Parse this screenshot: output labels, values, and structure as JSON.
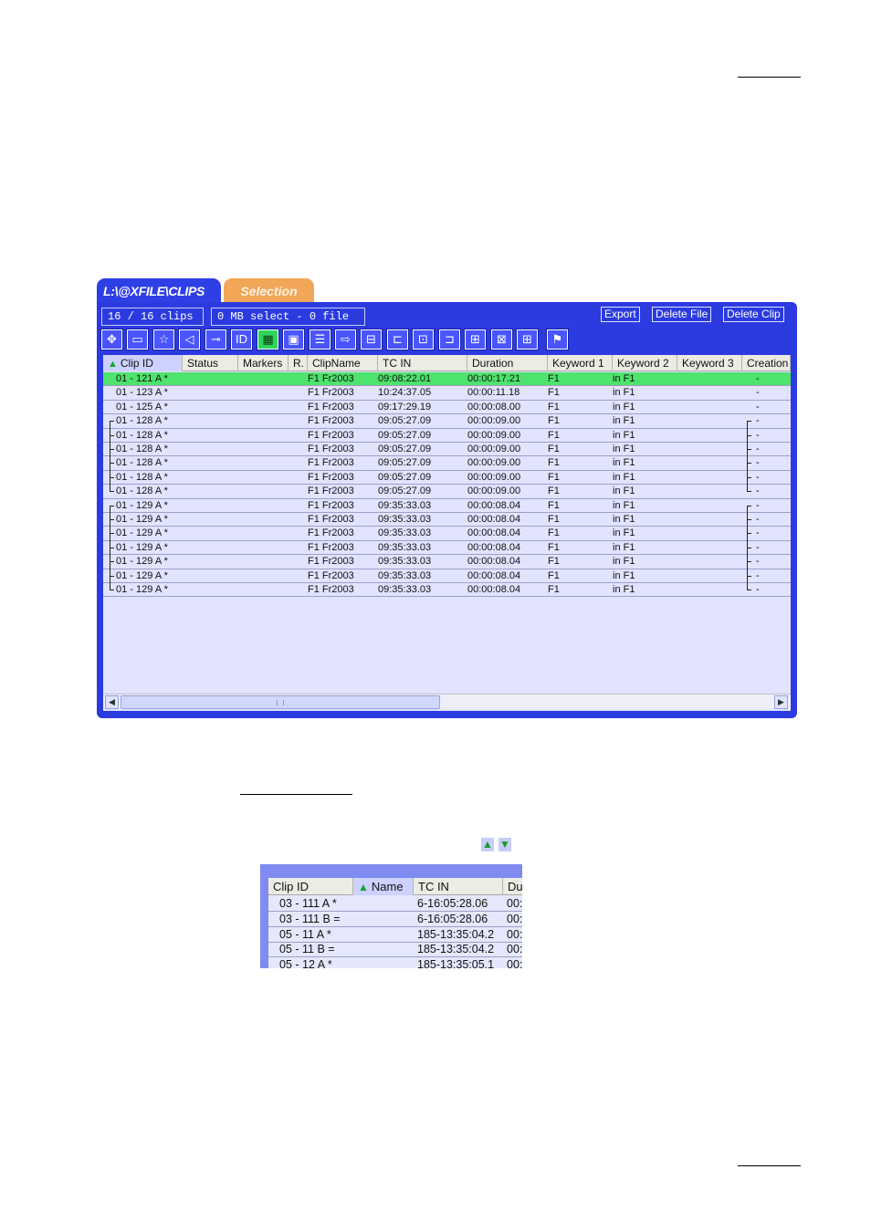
{
  "tabs": [
    {
      "label": "L:\\@XFILE\\CLIPS"
    },
    {
      "label": "Selection"
    }
  ],
  "status": {
    "clips_count": "16 / 16 clips",
    "selection_info": "0 MB select - 0 file"
  },
  "actions": {
    "export": "Export",
    "delete_file": "Delete File",
    "delete_clip": "Delete Clip"
  },
  "toolbar_icons": [
    "target-icon",
    "clip-icon",
    "star-icon",
    "tag-icon",
    "key-icon",
    "id-icon",
    "grid-view-icon",
    "frame-icon",
    "list-view-icon",
    "transfer-icon",
    "trim-icon",
    "mark-in-icon",
    "mark-frame-icon",
    "mark-out-icon",
    "split-icon",
    "join-icon",
    "merge-icon",
    "flag-icon"
  ],
  "table": {
    "columns": [
      "Clip ID",
      "Status",
      "Markers",
      "R.",
      "ClipName",
      "TC IN",
      "Duration",
      "Keyword 1",
      "Keyword 2",
      "Keyword 3",
      "Creation"
    ],
    "rows": [
      {
        "clip_id": "01 - 121 A *",
        "clipname": "F1 Fr2003",
        "tc_in": "09:08:22.01",
        "duration": "00:00:17.21",
        "kw1": "F1",
        "kw2": "in F1",
        "creation": "-",
        "selected": true,
        "group": ""
      },
      {
        "clip_id": "01 - 123 A *",
        "clipname": "F1 Fr2003",
        "tc_in": "10:24:37.05",
        "duration": "00:00:11.18",
        "kw1": "F1",
        "kw2": "in F1",
        "creation": "-",
        "group": ""
      },
      {
        "clip_id": "01 - 125 A *",
        "clipname": "F1 Fr2003",
        "tc_in": "09:17:29.19",
        "duration": "00:00:08.00",
        "kw1": "F1",
        "kw2": "in F1",
        "creation": "-",
        "group": ""
      },
      {
        "clip_id": "01 - 128 A *",
        "clipname": "F1 Fr2003",
        "tc_in": "09:05:27.09",
        "duration": "00:00:09.00",
        "kw1": "F1",
        "kw2": "in F1",
        "creation": "-",
        "group": "first"
      },
      {
        "clip_id": "01 - 128 A *",
        "clipname": "F1 Fr2003",
        "tc_in": "09:05:27.09",
        "duration": "00:00:09.00",
        "kw1": "F1",
        "kw2": "in F1",
        "creation": "-",
        "group": "mid"
      },
      {
        "clip_id": "01 - 128 A *",
        "clipname": "F1 Fr2003",
        "tc_in": "09:05:27.09",
        "duration": "00:00:09.00",
        "kw1": "F1",
        "kw2": "in F1",
        "creation": "-",
        "group": "mid"
      },
      {
        "clip_id": "01 - 128 A *",
        "clipname": "F1 Fr2003",
        "tc_in": "09:05:27.09",
        "duration": "00:00:09.00",
        "kw1": "F1",
        "kw2": "in F1",
        "creation": "-",
        "group": "mid"
      },
      {
        "clip_id": "01 - 128 A *",
        "clipname": "F1 Fr2003",
        "tc_in": "09:05:27.09",
        "duration": "00:00:09.00",
        "kw1": "F1",
        "kw2": "in F1",
        "creation": "-",
        "group": "mid"
      },
      {
        "clip_id": "01 - 128 A *",
        "clipname": "F1 Fr2003",
        "tc_in": "09:05:27.09",
        "duration": "00:00:09.00",
        "kw1": "F1",
        "kw2": "in F1",
        "creation": "-",
        "group": "last"
      },
      {
        "clip_id": "01 - 129 A *",
        "clipname": "F1 Fr2003",
        "tc_in": "09:35:33.03",
        "duration": "00:00:08.04",
        "kw1": "F1",
        "kw2": "in F1",
        "creation": "-",
        "group": "first"
      },
      {
        "clip_id": "01 - 129 A *",
        "clipname": "F1 Fr2003",
        "tc_in": "09:35:33.03",
        "duration": "00:00:08.04",
        "kw1": "F1",
        "kw2": "in F1",
        "creation": "-",
        "group": "mid"
      },
      {
        "clip_id": "01 - 129 A *",
        "clipname": "F1 Fr2003",
        "tc_in": "09:35:33.03",
        "duration": "00:00:08.04",
        "kw1": "F1",
        "kw2": "in F1",
        "creation": "-",
        "group": "mid"
      },
      {
        "clip_id": "01 - 129 A *",
        "clipname": "F1 Fr2003",
        "tc_in": "09:35:33.03",
        "duration": "00:00:08.04",
        "kw1": "F1",
        "kw2": "in F1",
        "creation": "-",
        "group": "mid"
      },
      {
        "clip_id": "01 - 129 A *",
        "clipname": "F1 Fr2003",
        "tc_in": "09:35:33.03",
        "duration": "00:00:08.04",
        "kw1": "F1",
        "kw2": "in F1",
        "creation": "-",
        "group": "mid"
      },
      {
        "clip_id": "01 - 129 A *",
        "clipname": "F1 Fr2003",
        "tc_in": "09:35:33.03",
        "duration": "00:00:08.04",
        "kw1": "F1",
        "kw2": "in F1",
        "creation": "-",
        "group": "mid"
      },
      {
        "clip_id": "01 - 129 A *",
        "clipname": "F1 Fr2003",
        "tc_in": "09:35:33.03",
        "duration": "00:00:08.04",
        "kw1": "F1",
        "kw2": "in F1",
        "creation": "-",
        "group": "last"
      }
    ]
  },
  "sort_icons": {
    "ascending": "▲",
    "descending": "▼"
  },
  "inset": {
    "columns": [
      "Clip ID",
      "Name",
      "TC IN",
      "Du"
    ],
    "rows": [
      {
        "clip_id": "03 - 111 A *",
        "tc_in": "6-16:05:28.06",
        "du": "00:"
      },
      {
        "clip_id": "03 - 111 B =",
        "tc_in": "6-16:05:28.06",
        "du": "00:"
      },
      {
        "clip_id": "05 - 11 A *",
        "tc_in": "185-13:35:04.2",
        "du": "00:"
      },
      {
        "clip_id": "05 - 11 B =",
        "tc_in": "185-13:35:04.2",
        "du": "00:"
      },
      {
        "clip_id": "05 - 12 A *",
        "tc_in": "185-13:35:05.1",
        "du": "00:"
      }
    ]
  },
  "colors": {
    "panel_blue": "#2b3be0",
    "selection_tab": "#f2a658",
    "selected_row": "#4ee36c",
    "grid_bg": "#e1e3ff"
  }
}
